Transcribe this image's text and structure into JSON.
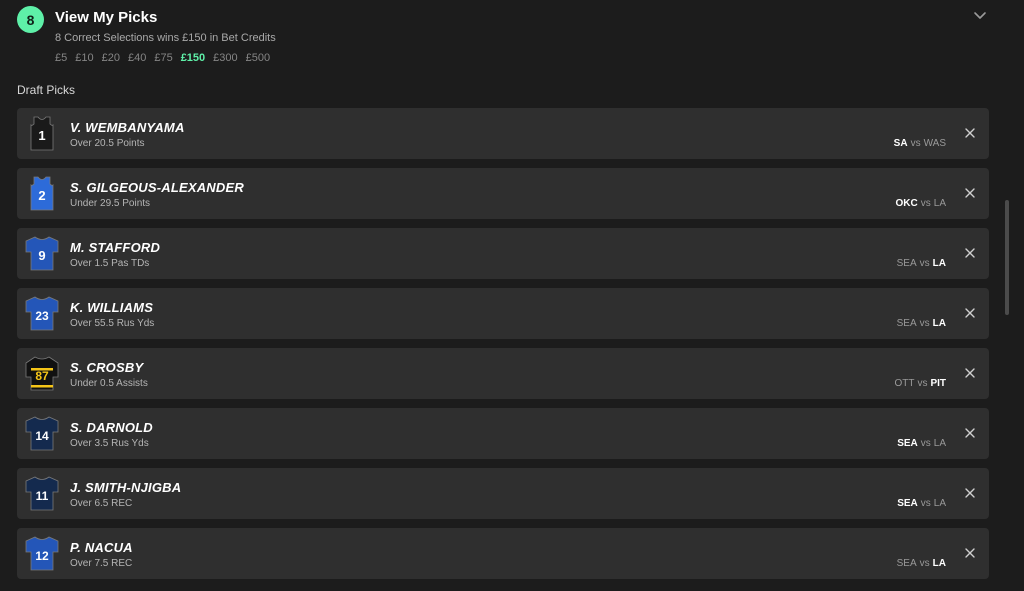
{
  "header": {
    "count": "8",
    "title": "View My Picks",
    "subtitle": "8 Correct Selections wins £150 in Bet Credits",
    "stakes": [
      "£5",
      "£10",
      "£20",
      "£40",
      "£75",
      "£150",
      "£300",
      "£500"
    ],
    "active_stake": "£150"
  },
  "section_title": "Draft Picks",
  "colors": {
    "accent": "#5ef0a8",
    "card": "#2f2f2f",
    "background": "#1c1c1c"
  },
  "picks": [
    {
      "player": "V. WEMBANYAMA",
      "market": "Over 20.5 Points",
      "home": "SA",
      "away": "WAS",
      "bold": "home",
      "jersey_number": "1",
      "jersey_type": "basketball",
      "jersey_color": "#1a1a1a",
      "number_color": "#ffffff",
      "icon": "basketball-jersey-icon"
    },
    {
      "player": "S. GILGEOUS-ALEXANDER",
      "market": "Under 29.5 Points",
      "home": "OKC",
      "away": "LA",
      "bold": "home",
      "jersey_number": "2",
      "jersey_type": "basketball",
      "jersey_color": "#2d6bd9",
      "number_color": "#ffffff",
      "icon": "basketball-jersey-icon"
    },
    {
      "player": "M. STAFFORD",
      "market": "Over 1.5 Pas TDs",
      "home": "SEA",
      "away": "LA",
      "bold": "away",
      "jersey_number": "9",
      "jersey_type": "football",
      "jersey_color": "#2456b8",
      "number_color": "#ffffff",
      "icon": "football-jersey-icon"
    },
    {
      "player": "K. WILLIAMS",
      "market": "Over 55.5 Rus Yds",
      "home": "SEA",
      "away": "LA",
      "bold": "away",
      "jersey_number": "23",
      "jersey_type": "football",
      "jersey_color": "#2456b8",
      "number_color": "#ffffff",
      "icon": "football-jersey-icon"
    },
    {
      "player": "S. CROSBY",
      "market": "Under 0.5 Assists",
      "home": "OTT",
      "away": "PIT",
      "bold": "away",
      "jersey_number": "87",
      "jersey_type": "hockey",
      "jersey_color": "#111111",
      "number_color": "#f5c518",
      "icon": "hockey-jersey-icon"
    },
    {
      "player": "S. DARNOLD",
      "market": "Over 3.5 Rus Yds",
      "home": "SEA",
      "away": "LA",
      "bold": "home",
      "jersey_number": "14",
      "jersey_type": "football",
      "jersey_color": "#142a4e",
      "number_color": "#ffffff",
      "icon": "football-jersey-icon"
    },
    {
      "player": "J. SMITH-NJIGBA",
      "market": "Over 6.5 REC",
      "home": "SEA",
      "away": "LA",
      "bold": "home",
      "jersey_number": "11",
      "jersey_type": "football",
      "jersey_color": "#142a4e",
      "number_color": "#ffffff",
      "icon": "football-jersey-icon"
    },
    {
      "player": "P. NACUA",
      "market": "Over 7.5 REC",
      "home": "SEA",
      "away": "LA",
      "bold": "away",
      "jersey_number": "12",
      "jersey_type": "football",
      "jersey_color": "#2456b8",
      "number_color": "#ffffff",
      "icon": "football-jersey-icon"
    }
  ],
  "labels": {
    "vs": "vs"
  },
  "icons": {
    "expand": "chevron-down-icon",
    "remove": "close-icon"
  }
}
